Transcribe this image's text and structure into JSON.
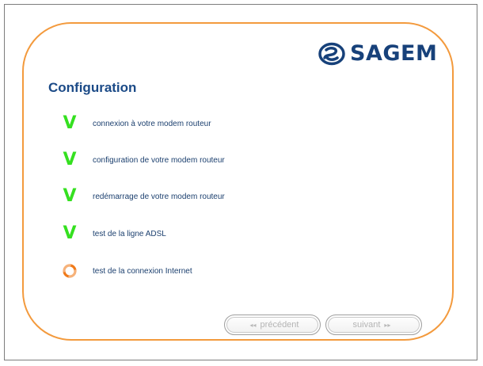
{
  "brand": {
    "logo_text": "SAGEM",
    "logo_color": "#17417a"
  },
  "page": {
    "title": "Configuration"
  },
  "steps": [
    {
      "label": "connexion à votre modem routeur",
      "status": "done",
      "icon": "check-icon"
    },
    {
      "label": "configuration de votre modem routeur",
      "status": "done",
      "icon": "check-icon"
    },
    {
      "label": "redémarrage de votre modem routeur",
      "status": "done",
      "icon": "check-icon"
    },
    {
      "label": "test de la ligne ADSL",
      "status": "done",
      "icon": "check-icon"
    },
    {
      "label": "test de la connexion Internet",
      "status": "in-progress",
      "icon": "spinner-icon"
    }
  ],
  "nav": {
    "previous_label": "précédent",
    "next_label": "suivant",
    "previous_arrows": "◂◂",
    "next_arrows": "▸▸"
  },
  "colors": {
    "panel_border": "#f39a3d",
    "check": "#35e020",
    "spinner": "#f07a1a",
    "title": "#1b4a87",
    "disabled_button_text": "#b4b4b4"
  }
}
